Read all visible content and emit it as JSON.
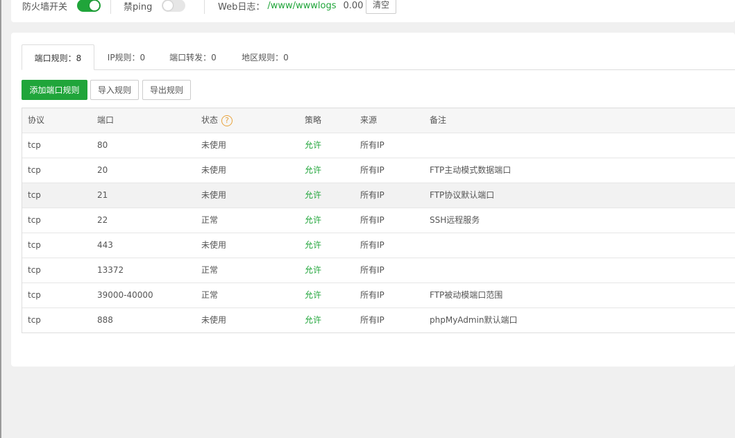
{
  "top": {
    "firewall_label": "防火墙开关",
    "firewall_on": true,
    "ping_label": "禁ping",
    "ping_on": false,
    "weblog_label": "Web日志：",
    "weblog_path": "/www/wwwlogs",
    "weblog_size": "0.00 b",
    "clear_label": "清空"
  },
  "tabs": [
    {
      "label": "端口规则：8",
      "active": true
    },
    {
      "label": "IP规则：0",
      "active": false
    },
    {
      "label": "端口转发：0",
      "active": false
    },
    {
      "label": "地区规则：0",
      "active": false
    }
  ],
  "toolbar": {
    "add_label": "添加端口规则",
    "import_label": "导入规则",
    "export_label": "导出规则"
  },
  "table": {
    "headers": {
      "protocol": "协议",
      "port": "端口",
      "status": "状态",
      "policy": "策略",
      "source": "来源",
      "remark": "备注"
    },
    "help_glyph": "?",
    "rows": [
      {
        "protocol": "tcp",
        "port": "80",
        "status": "未使用",
        "policy": "允许",
        "source": "所有IP",
        "remark": ""
      },
      {
        "protocol": "tcp",
        "port": "20",
        "status": "未使用",
        "policy": "允许",
        "source": "所有IP",
        "remark": "FTP主动模式数据端口"
      },
      {
        "protocol": "tcp",
        "port": "21",
        "status": "未使用",
        "policy": "允许",
        "source": "所有IP",
        "remark": "FTP协议默认端口"
      },
      {
        "protocol": "tcp",
        "port": "22",
        "status": "正常",
        "policy": "允许",
        "source": "所有IP",
        "remark": "SSH远程服务"
      },
      {
        "protocol": "tcp",
        "port": "443",
        "status": "未使用",
        "policy": "允许",
        "source": "所有IP",
        "remark": ""
      },
      {
        "protocol": "tcp",
        "port": "13372",
        "status": "正常",
        "policy": "允许",
        "source": "所有IP",
        "remark": ""
      },
      {
        "protocol": "tcp",
        "port": "39000-40000",
        "status": "正常",
        "policy": "允许",
        "source": "所有IP",
        "remark": "FTP被动模端口范围"
      },
      {
        "protocol": "tcp",
        "port": "888",
        "status": "未使用",
        "policy": "允许",
        "source": "所有IP",
        "remark": "phpMyAdmin默认端口"
      }
    ]
  },
  "colors": {
    "accent": "#20a53a",
    "warning": "#e8a33c"
  }
}
